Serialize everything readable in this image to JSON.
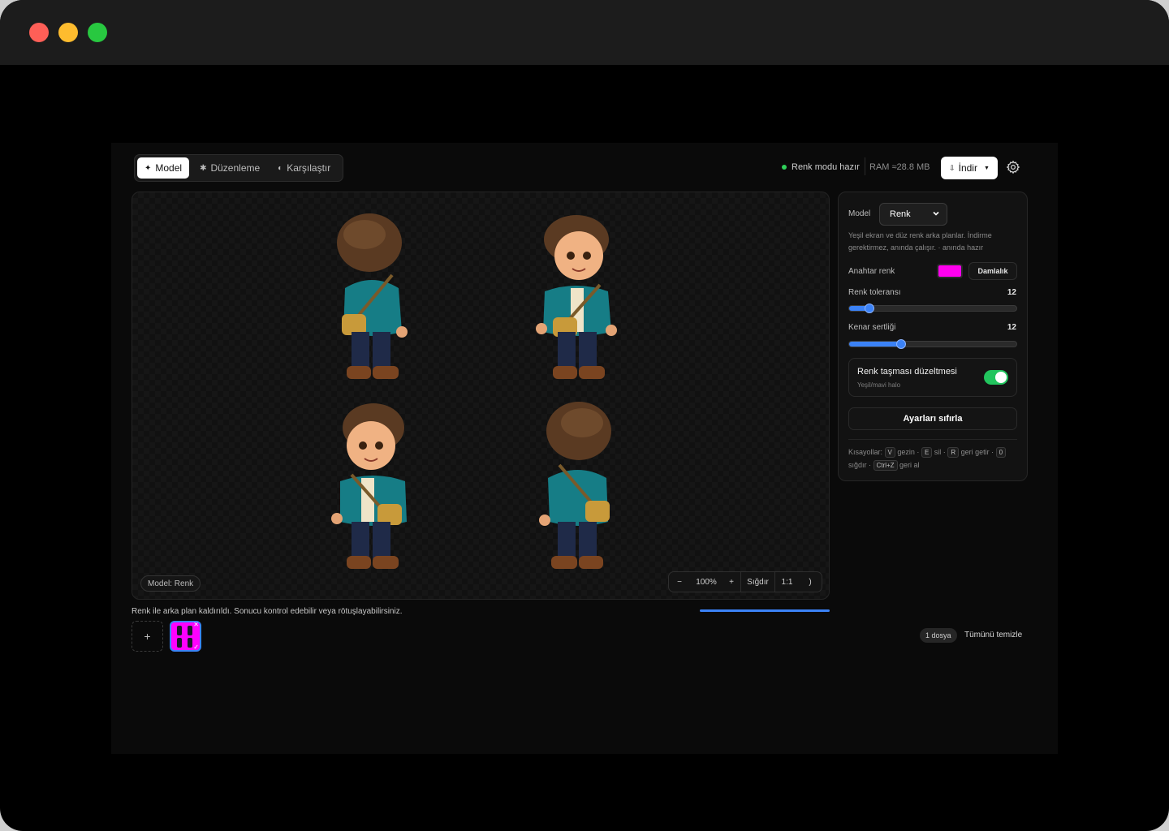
{
  "tabs": [
    {
      "label": "Model",
      "icon": "sparkle-icon",
      "active": true
    },
    {
      "label": "Düzenleme",
      "icon": "star-icon",
      "active": false
    },
    {
      "label": "Karşılaştır",
      "icon": "half-circle-icon",
      "active": false
    }
  ],
  "header": {
    "status": "Renk modu hazır",
    "ram": "RAM ≈28.8 MB",
    "download_label": "İndir",
    "status_color": "#2fd05a"
  },
  "canvas": {
    "model_badge": "Model: Renk",
    "zoom": {
      "minus": "−",
      "value": "100%",
      "plus": "+",
      "fit": "Sığdır",
      "one_to_one": "1:1",
      "next": ")"
    }
  },
  "result_message": "Renk ile arka plan kaldırıldı. Sonucu kontrol edebilir veya rötuşlayabilirsiniz.",
  "progress": 1.0,
  "files": {
    "add": "+",
    "count": "1 dosya",
    "clear_all": "Tümünü temizle",
    "thumb_color": "#ff00ff"
  },
  "panel": {
    "model_label": "Model",
    "model_value": "Renk",
    "description": "Yeşil ekran ve düz renk arka planlar. İndirme gerektirmez, anında çalışır. · anında hazır",
    "key_color_label": "Anahtar renk",
    "key_color": "#ff00ee",
    "dropper_label": "Damlalık",
    "tolerance_label": "Renk toleransı",
    "tolerance_value": "12",
    "tolerance_fraction": 0.12,
    "edge_label": "Kenar sertliği",
    "edge_value": "12",
    "edge_fraction": 0.31,
    "spill_title": "Renk taşması düzeltmesi",
    "spill_subtitle": "Yeşil/mavi halo",
    "spill_enabled": true,
    "reset_label": "Ayarları sıfırla",
    "shortcuts": {
      "prefix": "Kısayollar:",
      "k1": "V",
      "t1": "gezin ·",
      "k2": "E",
      "t2": "sil ·",
      "k3": "R",
      "t3": "geri getir ·",
      "k4": "0",
      "t4": "sığdır ·",
      "k5": "Ctrl+Z",
      "t5": "geri al"
    }
  }
}
